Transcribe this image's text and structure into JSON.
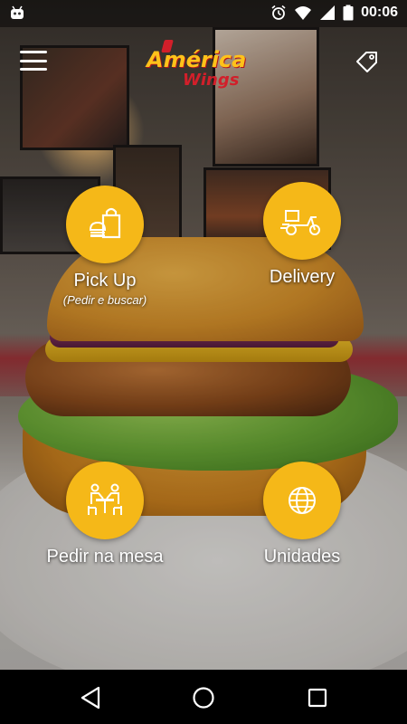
{
  "status_bar": {
    "time": "00:06",
    "icons": [
      "android-icon",
      "alarm-icon",
      "wifi-icon",
      "signal-icon",
      "battery-icon"
    ]
  },
  "header": {
    "menu_icon": "hamburger-menu-icon",
    "logo": {
      "line1": "América",
      "line2": "Wings"
    },
    "tag_icon": "tag-icon"
  },
  "menu": {
    "pickup": {
      "label": "Pick Up",
      "sublabel": "(Pedir e buscar)",
      "icon": "bag-burger-icon"
    },
    "delivery": {
      "label": "Delivery",
      "icon": "scooter-icon"
    },
    "mesa": {
      "label": "Pedir na mesa",
      "icon": "table-people-icon"
    },
    "unidades": {
      "label": "Unidades",
      "icon": "globe-icon"
    }
  },
  "colors": {
    "accent": "#f5b818",
    "logo_yellow": "#ffc21a",
    "logo_red": "#d21f2a"
  },
  "nav": {
    "icons": [
      "back-icon",
      "home-icon",
      "recents-icon"
    ]
  }
}
